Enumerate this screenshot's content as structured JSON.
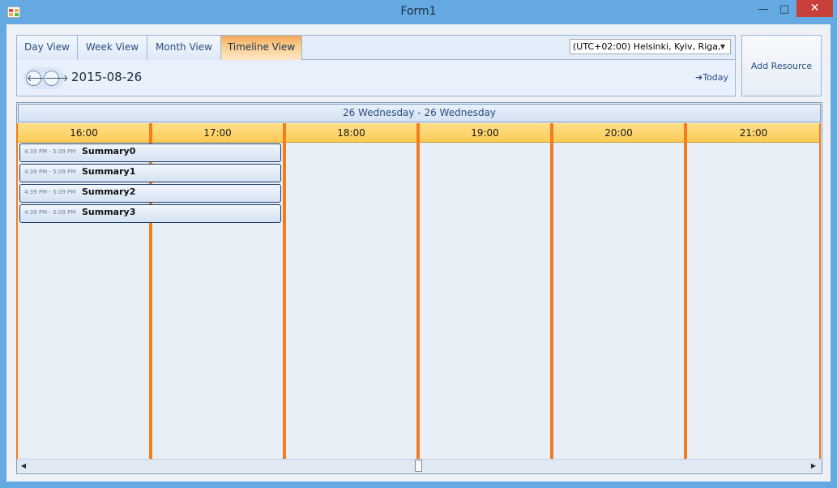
{
  "window": {
    "title": "Form1",
    "minimize_glyph": "—",
    "maximize_glyph": "□",
    "close_glyph": "✕"
  },
  "tabs": [
    {
      "label": "Day View"
    },
    {
      "label": "Week View"
    },
    {
      "label": "Month View"
    },
    {
      "label": "Timeline View",
      "active": true
    }
  ],
  "timezone": {
    "value": "(UTC+02:00) Helsinki, Kyiv, Riga,"
  },
  "nav": {
    "prev_glyph": "🡐",
    "next_glyph": "🡒",
    "date": "2015-08-26",
    "today_label": "Today",
    "today_glyph": "➔"
  },
  "add_resource_label": "Add Resource",
  "scheduler": {
    "day_header": "26 Wednesday - 26 Wednesday",
    "hours": [
      "16:00",
      "17:00",
      "18:00",
      "19:00",
      "20:00",
      "21:00"
    ],
    "appointments": [
      {
        "time": "4:39 PM - 5:09 PM",
        "summary": "Summary0"
      },
      {
        "time": "4:39 PM - 5:09 PM",
        "summary": "Summary1"
      },
      {
        "time": "4:39 PM - 5:09 PM",
        "summary": "Summary2"
      },
      {
        "time": "4:39 PM - 5:09 PM",
        "summary": "Summary3"
      }
    ]
  },
  "scrollbar": {
    "left_glyph": "◀",
    "right_glyph": "▶"
  },
  "colors": {
    "accent_orange": "#f47c1d",
    "header_yellow": "#fccb56",
    "title_bar": "#65a9e2",
    "close_red": "#c9403a"
  }
}
